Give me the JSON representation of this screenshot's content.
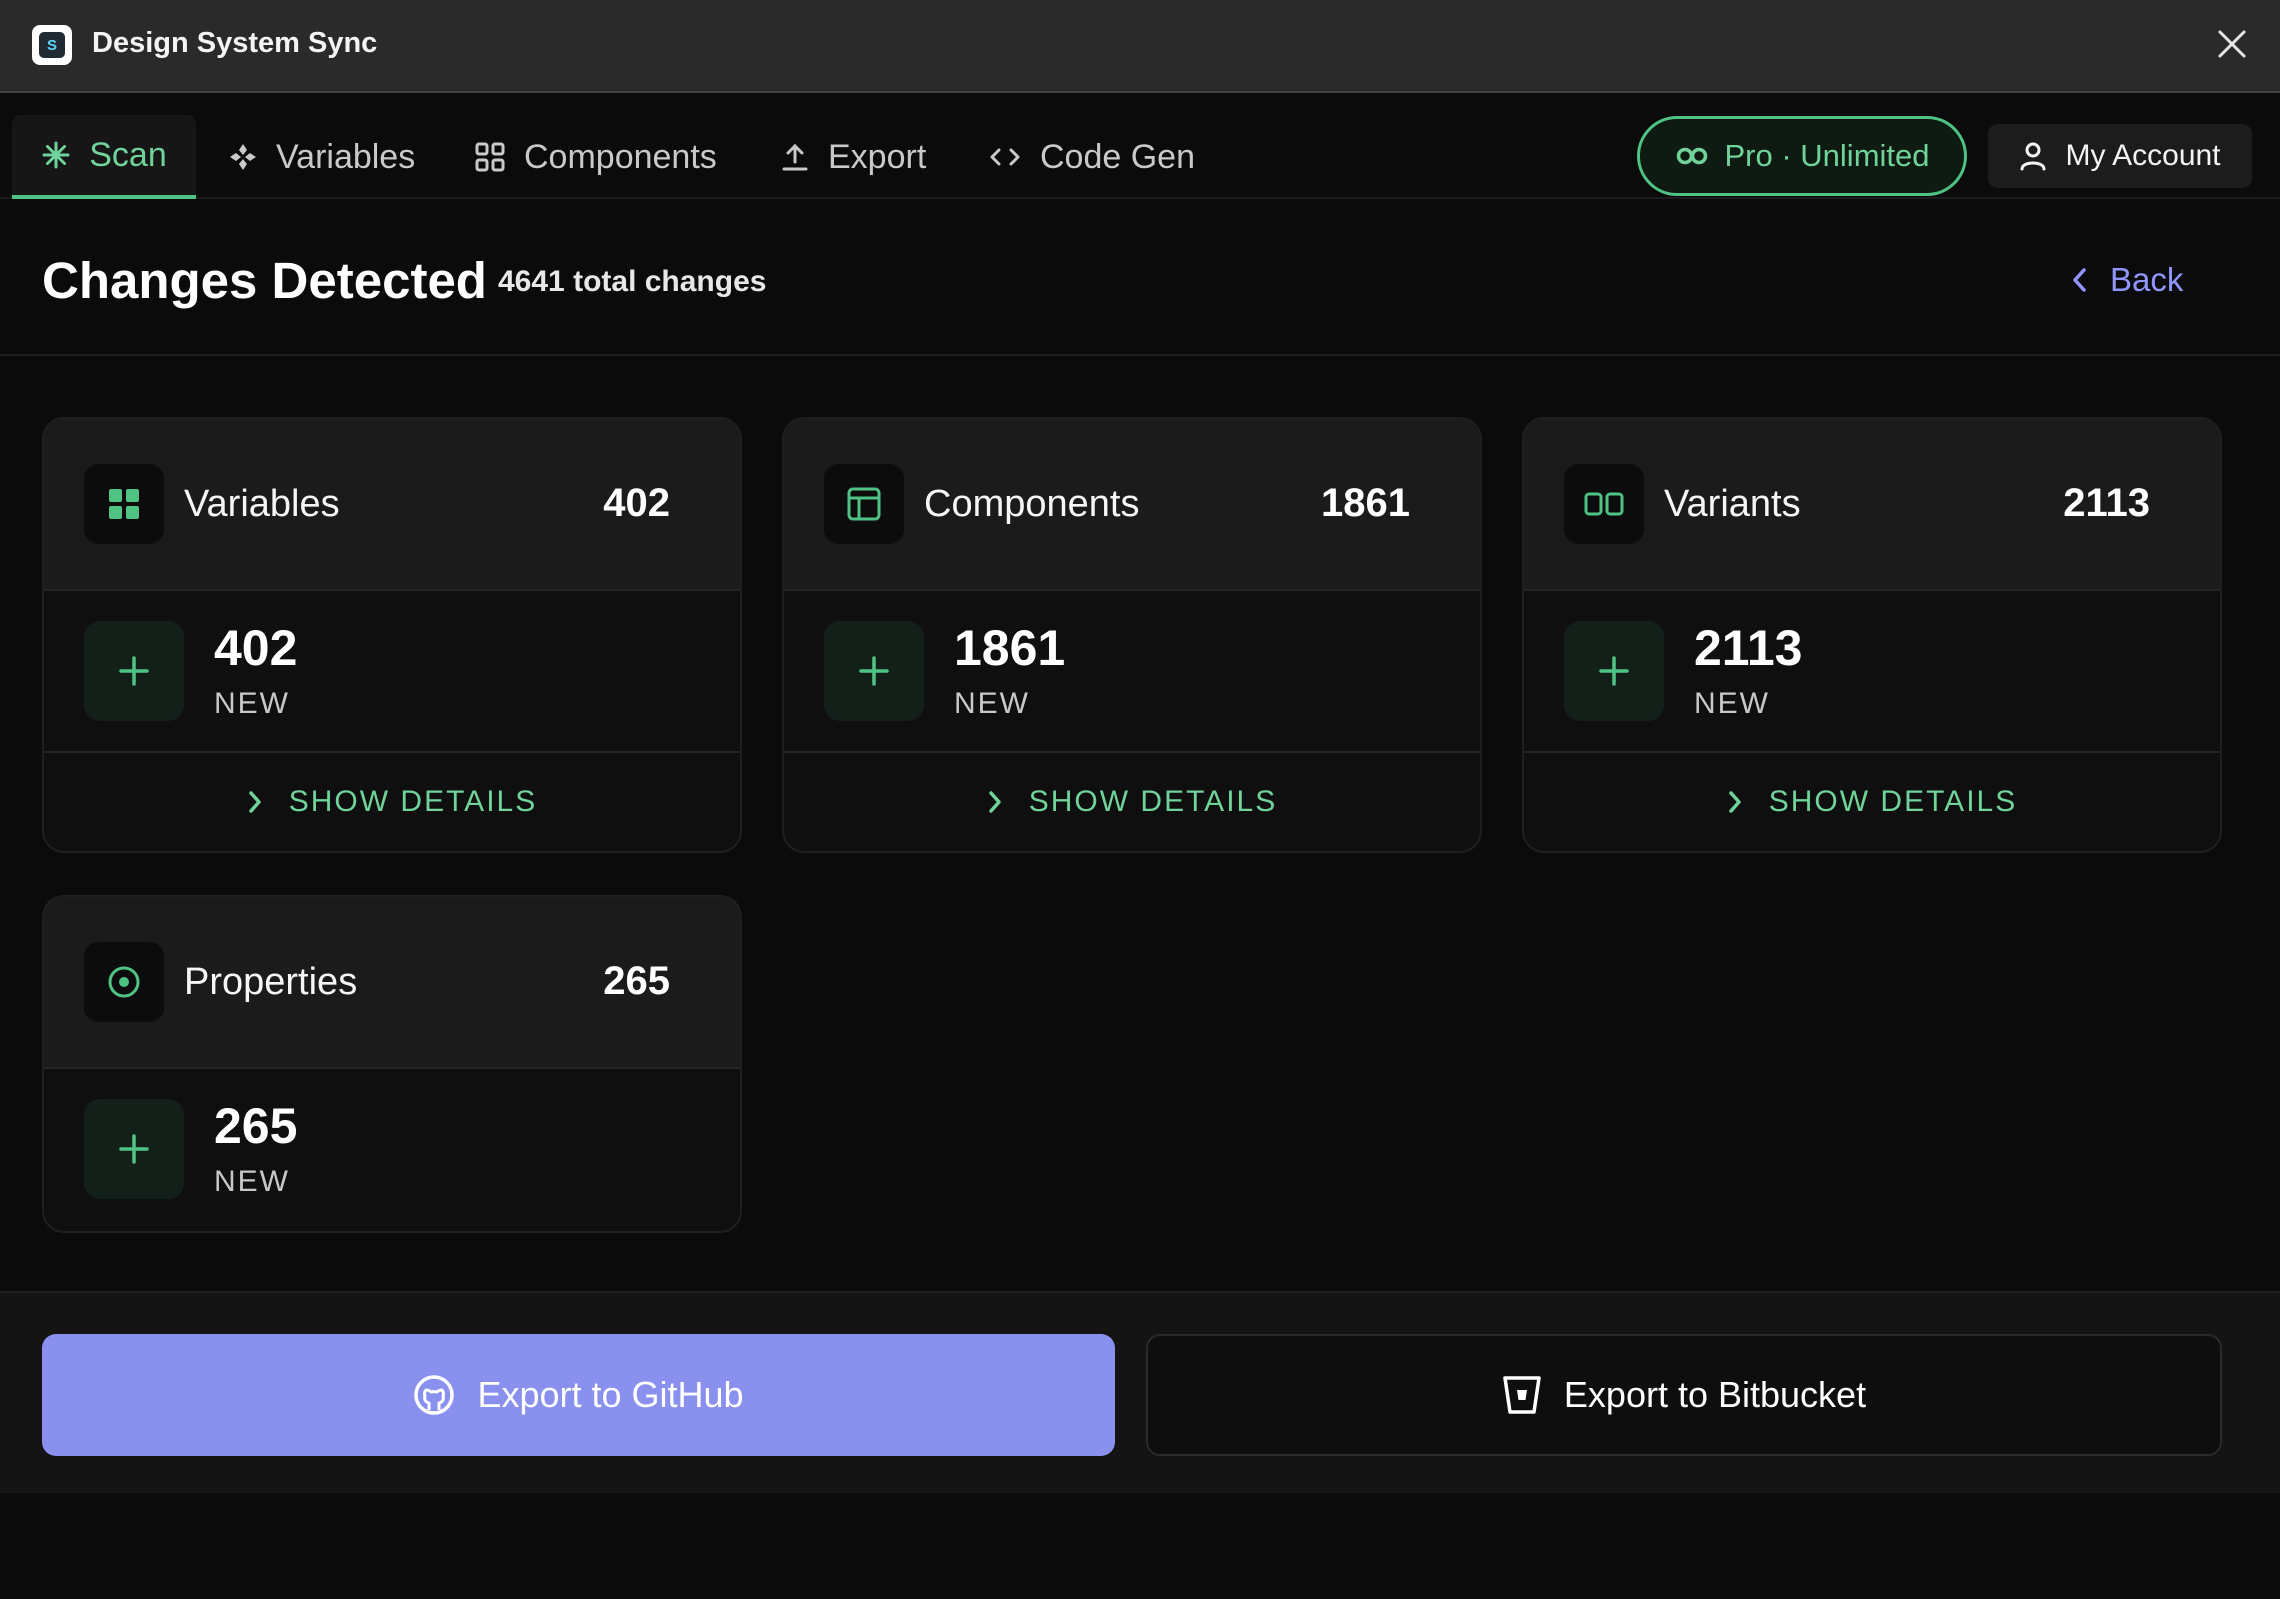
{
  "window": {
    "title": "Design System Sync",
    "logo_letter": "S",
    "close_icon": "close-icon"
  },
  "tabs": [
    {
      "label": "Scan",
      "icon": "sparkle-icon",
      "active": true
    },
    {
      "label": "Variables",
      "icon": "variables-icon",
      "active": false
    },
    {
      "label": "Components",
      "icon": "components-grid-icon",
      "active": false
    },
    {
      "label": "Export",
      "icon": "upload-icon",
      "active": false
    },
    {
      "label": "Code Gen",
      "icon": "code-icon",
      "active": false
    }
  ],
  "plan": {
    "label": "Pro · Unlimited",
    "icon": "infinity-icon"
  },
  "account": {
    "label": "My Account",
    "icon": "user-icon"
  },
  "header": {
    "title": "Changes Detected",
    "total": "4641 total changes",
    "back_label": "Back"
  },
  "cards": [
    {
      "name": "Variables",
      "count": "402",
      "new_count": "402",
      "new_label": "NEW",
      "details_label": "SHOW DETAILS",
      "icon": "variables-grid-icon"
    },
    {
      "name": "Components",
      "count": "1861",
      "new_count": "1861",
      "new_label": "NEW",
      "details_label": "SHOW DETAILS",
      "icon": "layout-icon"
    },
    {
      "name": "Variants",
      "count": "2113",
      "new_count": "2113",
      "new_label": "NEW",
      "details_label": "SHOW DETAILS",
      "icon": "variants-icon"
    },
    {
      "name": "Properties",
      "count": "265",
      "new_count": "265",
      "new_label": "NEW",
      "icon": "target-icon"
    }
  ],
  "actions": {
    "github_label": "Export to GitHub",
    "bitbucket_label": "Export to Bitbucket"
  },
  "colors": {
    "accent_green": "#4fc384",
    "accent_purple": "#8a90ee",
    "background": "#0b0b0b"
  }
}
